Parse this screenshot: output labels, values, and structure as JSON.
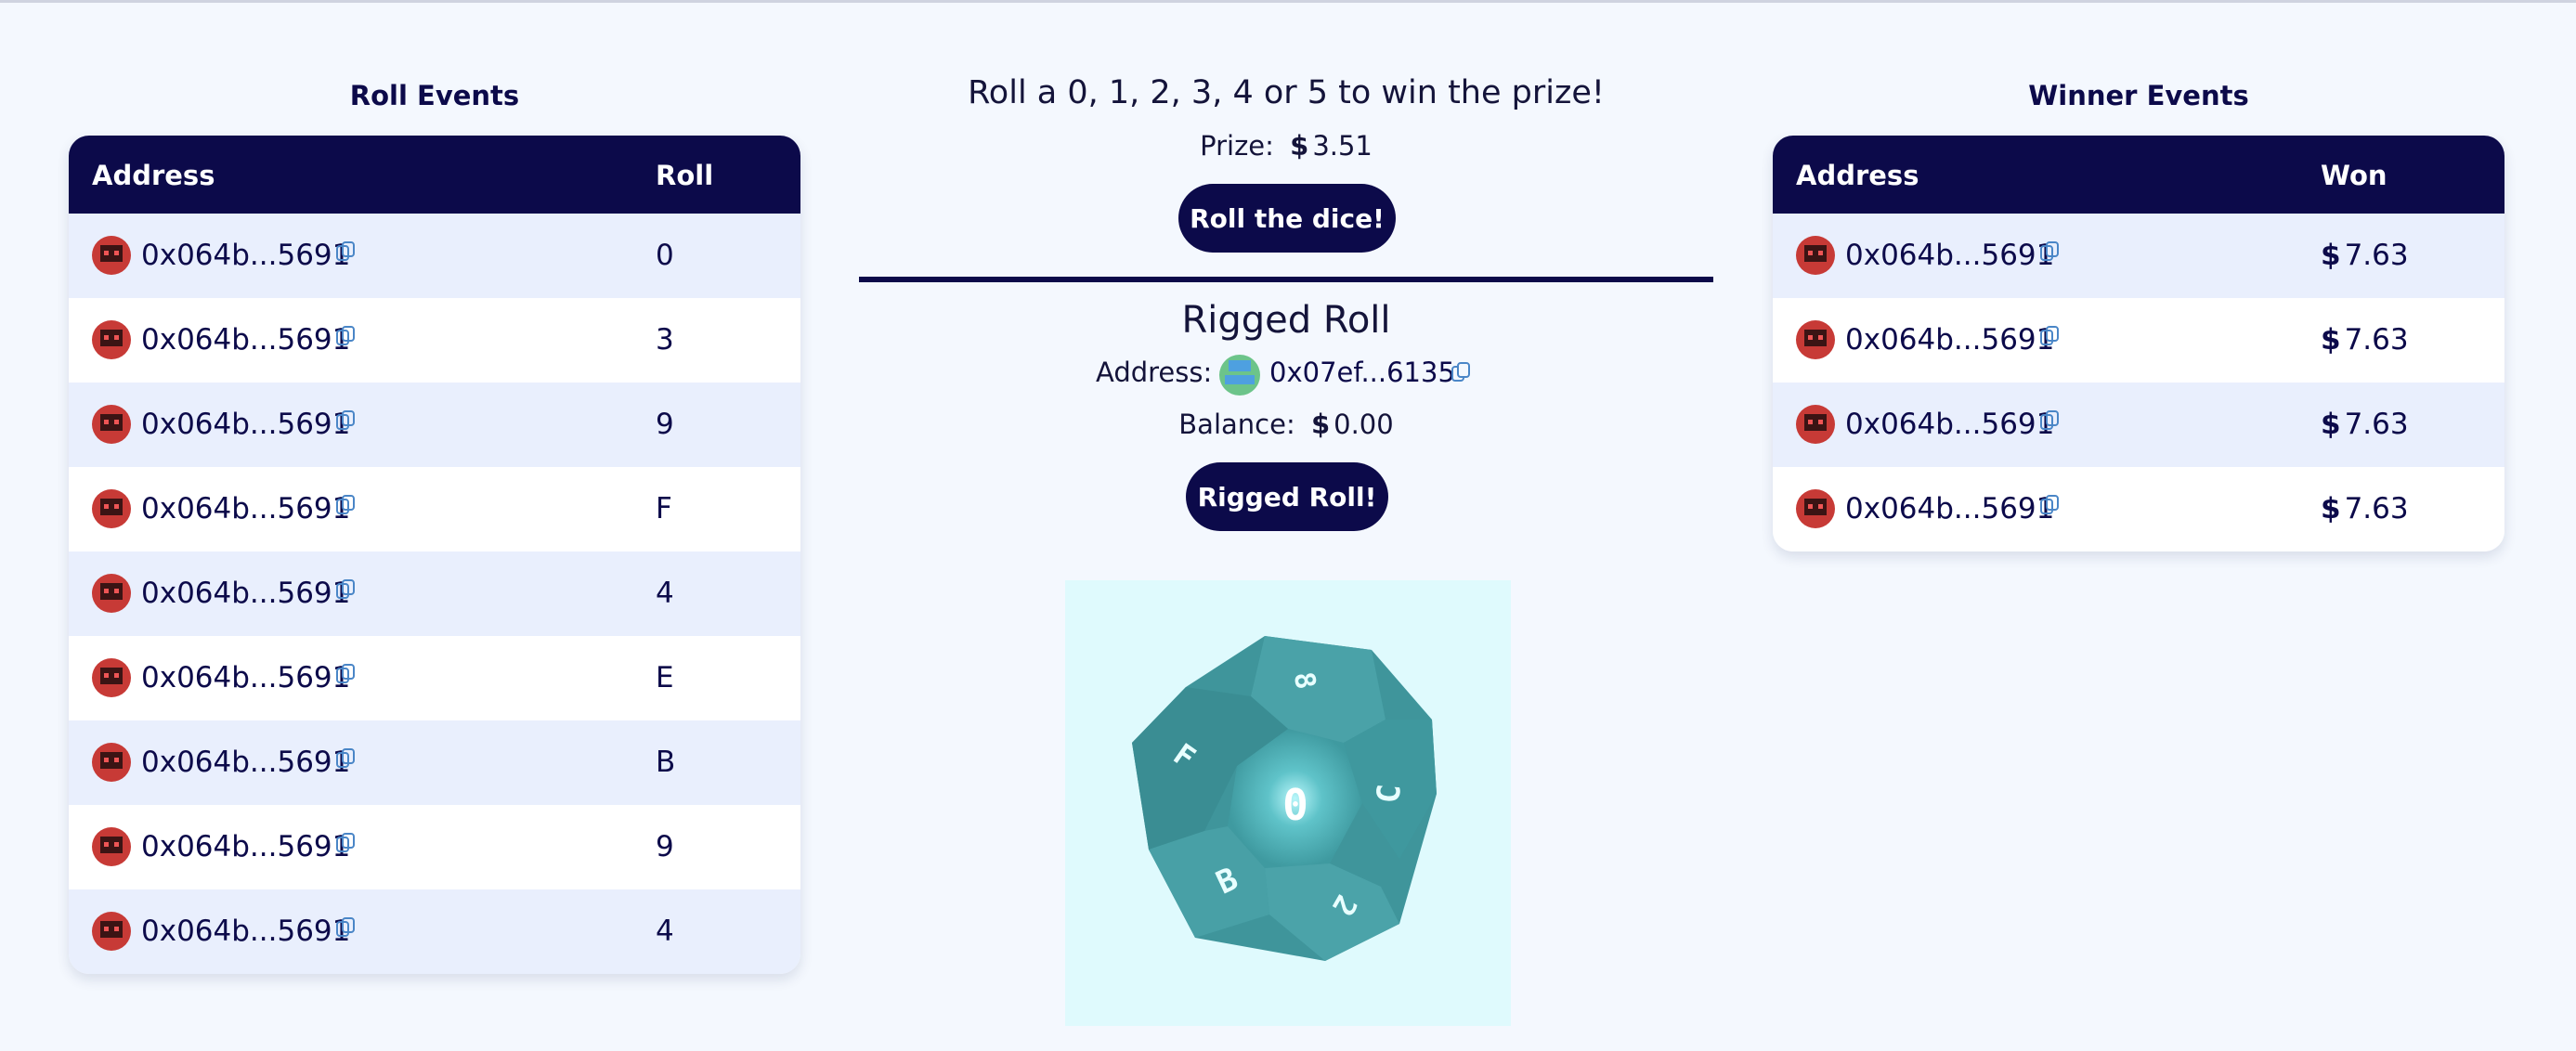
{
  "roll_events": {
    "title": "Roll Events",
    "columns": [
      "Address",
      "Roll"
    ],
    "rows": [
      {
        "address": "0x064b...5691",
        "roll": "0"
      },
      {
        "address": "0x064b...5691",
        "roll": "3"
      },
      {
        "address": "0x064b...5691",
        "roll": "9"
      },
      {
        "address": "0x064b...5691",
        "roll": "F"
      },
      {
        "address": "0x064b...5691",
        "roll": "4"
      },
      {
        "address": "0x064b...5691",
        "roll": "E"
      },
      {
        "address": "0x064b...5691",
        "roll": "B"
      },
      {
        "address": "0x064b...5691",
        "roll": "9"
      },
      {
        "address": "0x064b...5691",
        "roll": "4"
      }
    ]
  },
  "game": {
    "headline": "Roll a 0, 1, 2, 3, 4 or 5 to win the prize!",
    "prize_label": "Prize:",
    "prize_currency": "$",
    "prize_value": "3.51",
    "roll_button": "Roll the dice!",
    "rigged_title": "Rigged Roll",
    "address_label": "Address:",
    "address_value": "0x07ef...6135",
    "balance_label": "Balance:",
    "balance_currency": "$",
    "balance_value": "0.00",
    "rigged_button": "Rigged Roll!",
    "dice_faces": {
      "top": "0",
      "upper_right": "8",
      "right": "C",
      "left": "F",
      "lower_left": "B",
      "lower_right": "2"
    }
  },
  "winner_events": {
    "title": "Winner Events",
    "columns": [
      "Address",
      "Won"
    ],
    "rows": [
      {
        "address": "0x064b...5691",
        "currency": "$",
        "won": "7.63"
      },
      {
        "address": "0x064b...5691",
        "currency": "$",
        "won": "7.63"
      },
      {
        "address": "0x064b...5691",
        "currency": "$",
        "won": "7.63"
      },
      {
        "address": "0x064b...5691",
        "currency": "$",
        "won": "7.63"
      }
    ]
  },
  "colors": {
    "navy": "#0c0a4a",
    "row_alt": "#e9effd",
    "background": "#f4f8fe",
    "die": "#3f9aa0",
    "link_blue": "#4a86c7"
  }
}
